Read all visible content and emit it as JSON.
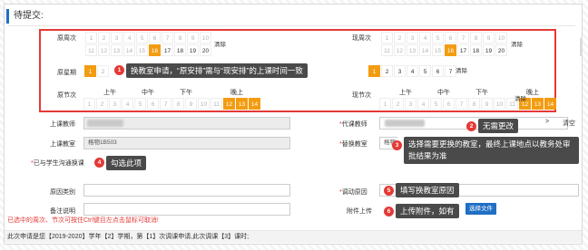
{
  "page": {
    "title": "待提交:"
  },
  "colors": {
    "accent": "#f39c12",
    "brand": "#1f6fc5",
    "highlight_box": "#e53935",
    "tooltip_bg": "#4a4a4a"
  },
  "weeks": {
    "orig_label": "原周次",
    "new_label": "现周次",
    "numbers": [
      "1",
      "2",
      "3",
      "4",
      "5",
      "6",
      "7",
      "8",
      "9",
      "10",
      "11",
      "12",
      "13",
      "14",
      "15",
      "16",
      "17",
      "18",
      "19",
      "20"
    ],
    "orig_selected": [
      "16"
    ],
    "orig_active": [
      "17",
      "18",
      "19",
      "20"
    ],
    "new_selected": [
      "16"
    ],
    "new_active": [
      "17",
      "18",
      "19",
      "20"
    ],
    "clear_label": "清除"
  },
  "weekday": {
    "orig_label": "原星期",
    "orig_selected": "1",
    "orig_partial": [
      "2"
    ],
    "new_numbers": [
      "1",
      "2",
      "3",
      "4",
      "5",
      "6",
      "7"
    ],
    "new_selected": "1",
    "clear_label": "清除"
  },
  "sections": {
    "orig_label": "原节次",
    "new_label": "现节次",
    "morning": "上午",
    "noon": "中午",
    "afternoon": "下午",
    "evening": "晚上",
    "numbers": [
      "1",
      "2",
      "3",
      "4",
      "5",
      "6",
      "7",
      "8",
      "9",
      "10",
      "11",
      "12",
      "13",
      "14"
    ],
    "selected": [
      "12",
      "13",
      "14"
    ],
    "clear_label": "清除"
  },
  "form": {
    "teacher_label": "上课教师",
    "sub_teacher_label": "代课教师",
    "room_label": "上课教室",
    "new_room_label": "替换教室",
    "room_value": "格物1B503",
    "new_room_value": "格物",
    "communicated_label": "已与学生沟通换课",
    "reason_type_label": "原因类别",
    "adjust_reason_label": "调动原因",
    "remark_label": "备注说明",
    "attachment_label": "附件上传",
    "upload_btn": "选择文件",
    "picker_btn": ">",
    "clear_btn": "清空",
    "required_mark": "*"
  },
  "annotations": [
    {
      "num": "1",
      "text": "换教室申请，“原安排”需与“现安排”的上课时间一致"
    },
    {
      "num": "2",
      "text": "无需更改"
    },
    {
      "num": "3",
      "text": "选择需要更换的教室，最终上课地点以教务处审批结果为准"
    },
    {
      "num": "4",
      "text": "勾选此项"
    },
    {
      "num": "5",
      "text": "填写换教室原因"
    },
    {
      "num": "6",
      "text": "上传附件，如有"
    }
  ],
  "notes": {
    "selection_hint": "已选中的周次、节次可按住Ctrl键且左点击鼠标可取消!",
    "footer": "此次申请是您【2019-2020】学年【2】学期，第【1】次调课申请,此次调课【3】课时;"
  }
}
